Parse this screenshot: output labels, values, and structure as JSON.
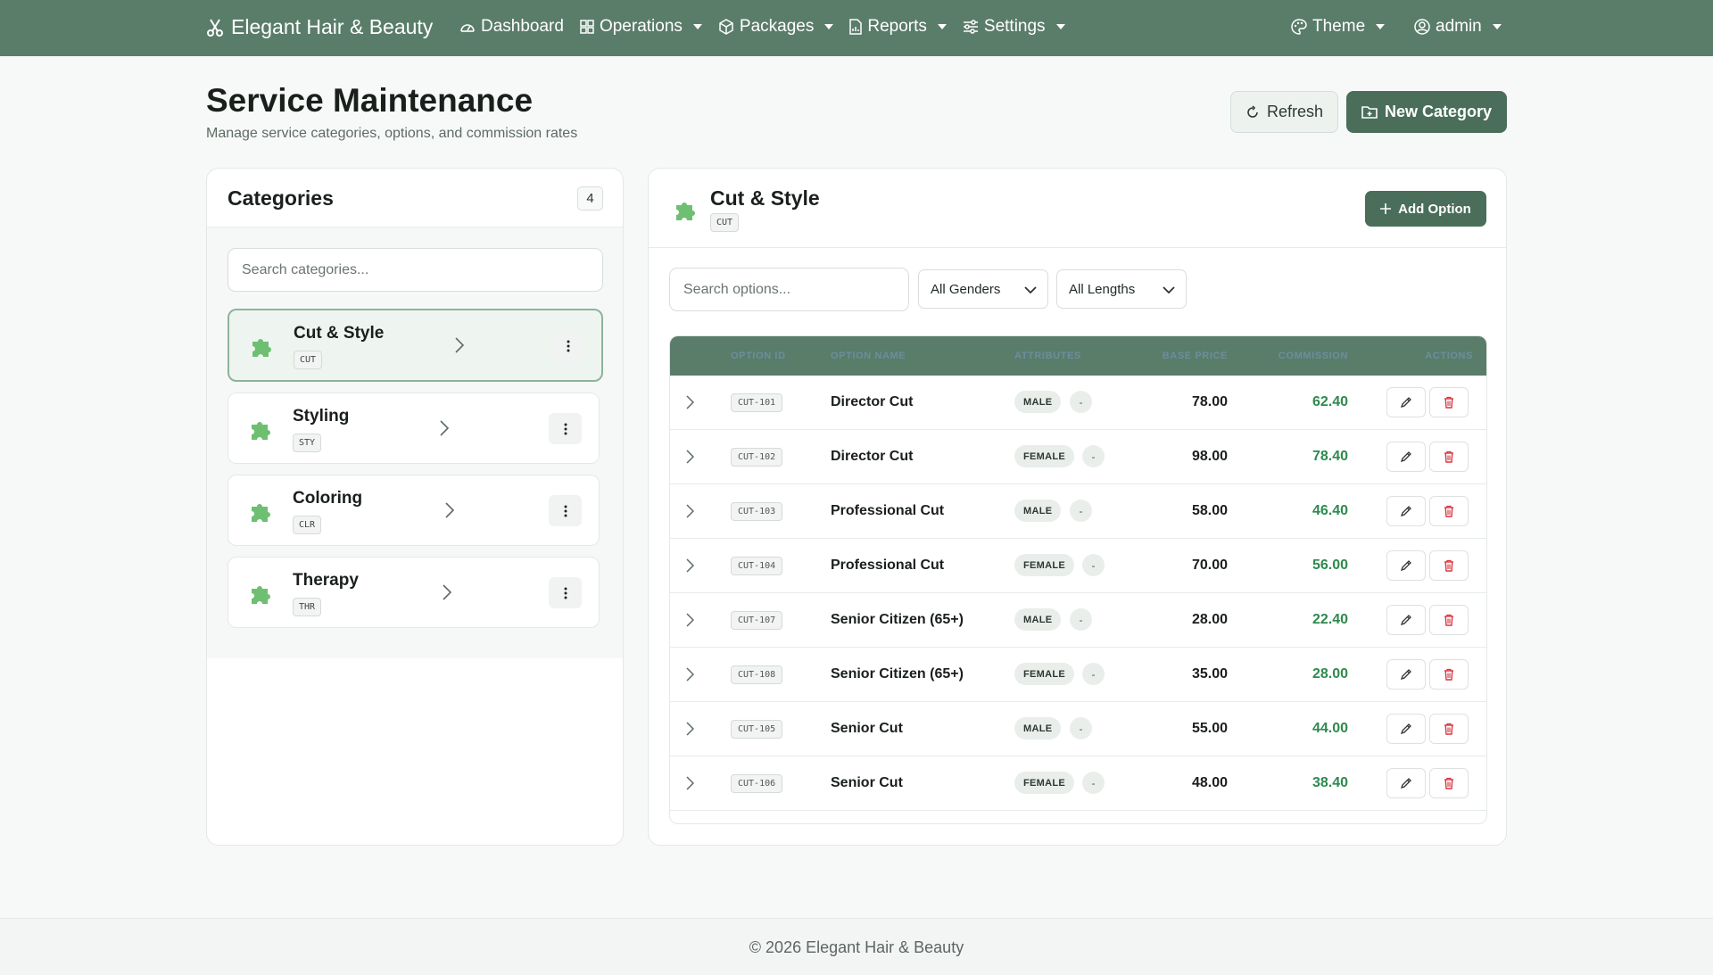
{
  "app": {
    "brand": "Elegant Hair & Beauty",
    "nav": [
      {
        "label": "Dashboard",
        "icon": "gauge-icon"
      },
      {
        "label": "Operations",
        "icon": "grid-icon"
      },
      {
        "label": "Packages",
        "icon": "box-icon"
      },
      {
        "label": "Reports",
        "icon": "report-icon"
      },
      {
        "label": "Settings",
        "icon": "sliders-icon"
      }
    ],
    "theme_label": "Theme",
    "user_label": "admin"
  },
  "page": {
    "title": "Service Maintenance",
    "subtitle": "Manage service categories, options, and commission rates",
    "refresh_label": "Refresh",
    "new_category_label": "New Category"
  },
  "categories": {
    "title": "Categories",
    "count": "4",
    "search_placeholder": "Search categories...",
    "items": [
      {
        "name": "Cut & Style",
        "code": "CUT",
        "active": true
      },
      {
        "name": "Styling",
        "code": "STY",
        "active": false
      },
      {
        "name": "Coloring",
        "code": "CLR",
        "active": false
      },
      {
        "name": "Therapy",
        "code": "THR",
        "active": false
      }
    ]
  },
  "detail": {
    "title": "Cut & Style",
    "code": "CUT",
    "add_option_label": "Add Option",
    "search_placeholder": "Search options...",
    "gender_filter": "All Genders",
    "length_filter": "All Lengths",
    "columns": [
      "Option ID",
      "Option Name",
      "Attributes",
      "Base Price",
      "Commission",
      "Actions"
    ],
    "rows": [
      {
        "code": "CUT-101",
        "name": "Director Cut",
        "gender": "MALE",
        "length": "-",
        "price": "78.00",
        "commission": "62.40"
      },
      {
        "code": "CUT-102",
        "name": "Director Cut",
        "gender": "FEMALE",
        "length": "-",
        "price": "98.00",
        "commission": "78.40"
      },
      {
        "code": "CUT-103",
        "name": "Professional Cut",
        "gender": "MALE",
        "length": "-",
        "price": "58.00",
        "commission": "46.40"
      },
      {
        "code": "CUT-104",
        "name": "Professional Cut",
        "gender": "FEMALE",
        "length": "-",
        "price": "70.00",
        "commission": "56.00"
      },
      {
        "code": "CUT-107",
        "name": "Senior Citizen (65+)",
        "gender": "MALE",
        "length": "-",
        "price": "28.00",
        "commission": "22.40"
      },
      {
        "code": "CUT-108",
        "name": "Senior Citizen (65+)",
        "gender": "FEMALE",
        "length": "-",
        "price": "35.00",
        "commission": "28.00"
      },
      {
        "code": "CUT-105",
        "name": "Senior Cut",
        "gender": "MALE",
        "length": "-",
        "price": "55.00",
        "commission": "44.00"
      },
      {
        "code": "CUT-106",
        "name": "Senior Cut",
        "gender": "FEMALE",
        "length": "-",
        "price": "48.00",
        "commission": "38.40"
      }
    ]
  },
  "colors": {
    "primary": "#5a7d6a",
    "button": "#4a6e5a",
    "commission": "#2e8a4e",
    "danger": "#d9363e"
  },
  "footer": {
    "text": "© 2026 Elegant Hair & Beauty"
  }
}
